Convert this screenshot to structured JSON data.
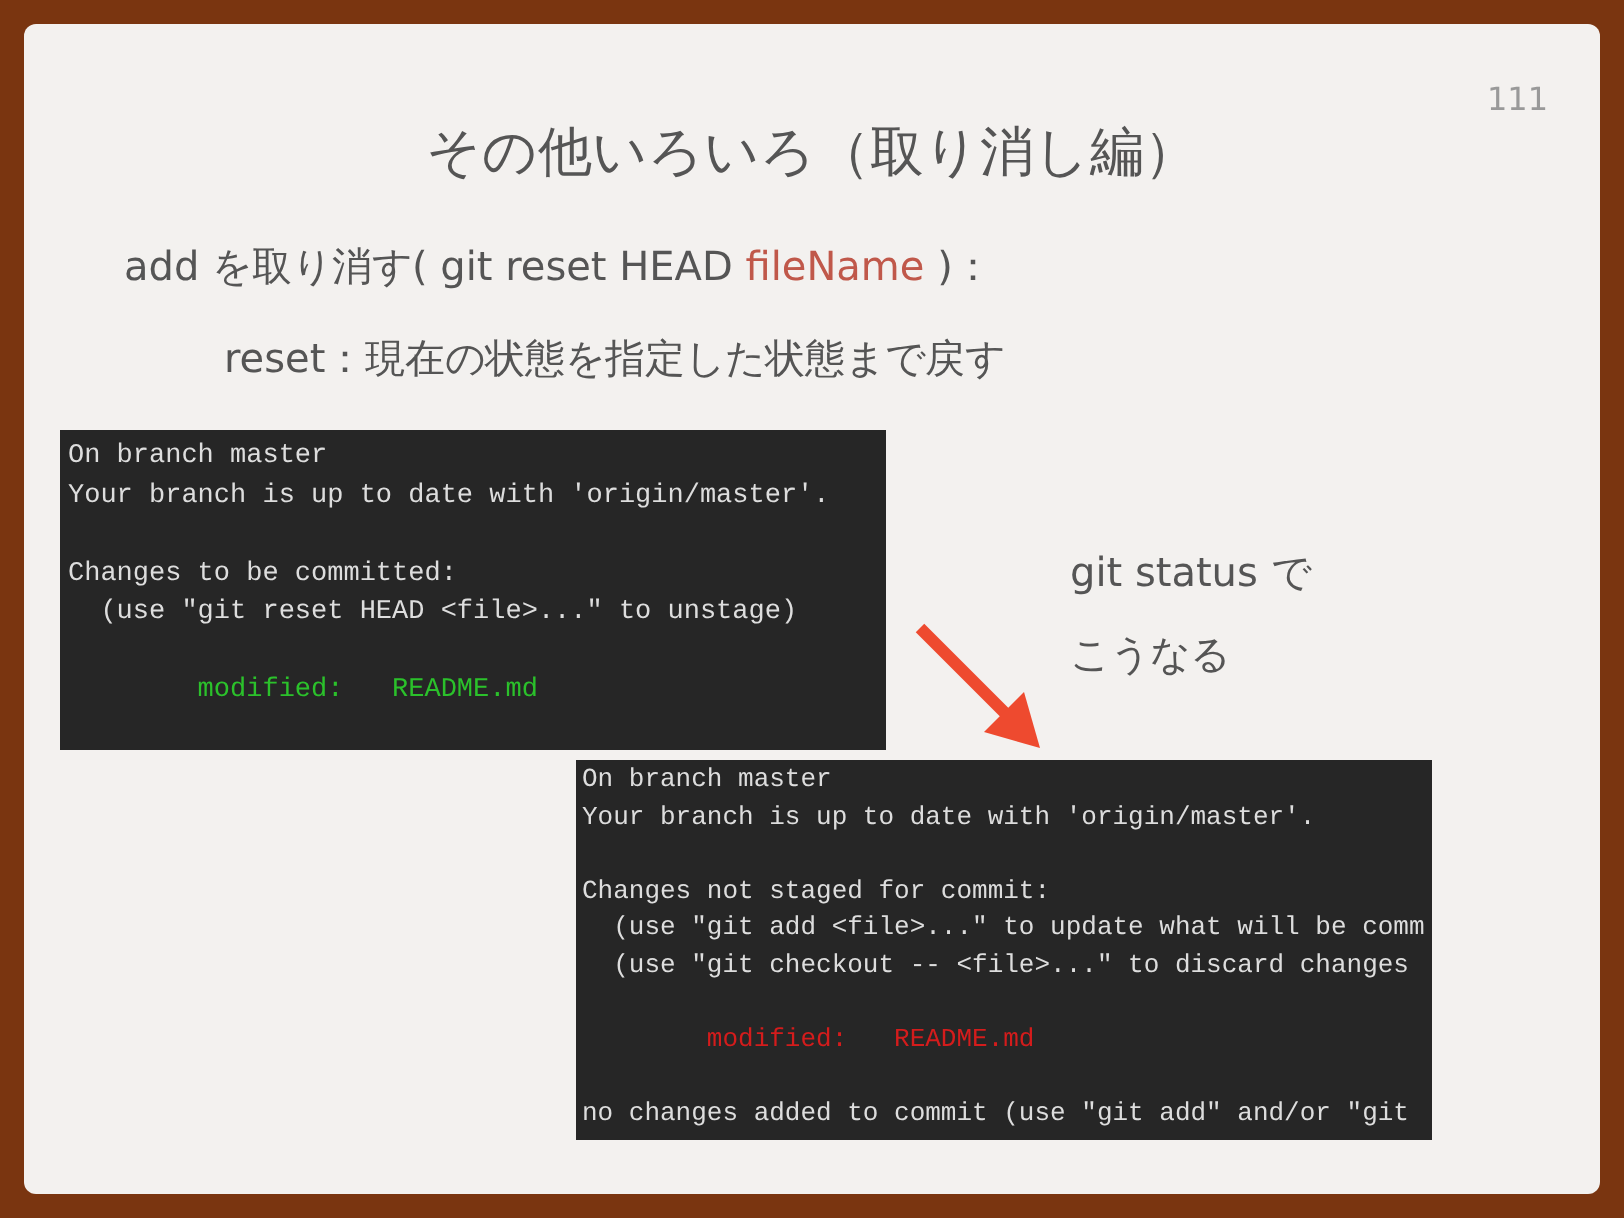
{
  "slide": {
    "page_number": "111",
    "title": "その他いろいろ（取り消し編）",
    "bullets": [
      {
        "segments": [
          {
            "text": "add を取り消す( git reset HEAD ",
            "kind": "plain"
          },
          {
            "text": "fileName",
            "kind": "placeholder"
          },
          {
            "text": " )：",
            "kind": "plain"
          }
        ]
      },
      {
        "segments": [
          {
            "text": "reset：現在の状態を指定した状態まで戻す",
            "kind": "plain"
          }
        ]
      }
    ],
    "terminals": [
      {
        "lines": [
          {
            "kind": "text",
            "text": "On branch master"
          },
          {
            "kind": "text",
            "text": "Your branch is up to date with 'origin/master'."
          },
          {
            "kind": "blank"
          },
          {
            "kind": "text",
            "text": "Changes to be committed:"
          },
          {
            "kind": "text",
            "text": "  (use \"git reset HEAD <file>...\" to unstage)"
          },
          {
            "kind": "blank"
          },
          {
            "kind": "status",
            "text": "        modified:   README.md",
            "color": "#2bc12b"
          }
        ]
      },
      {
        "lines": [
          {
            "kind": "text",
            "text": "On branch master"
          },
          {
            "kind": "text",
            "text": "Your branch is up to date with 'origin/master'."
          },
          {
            "kind": "blank"
          },
          {
            "kind": "text",
            "text": "Changes not staged for commit:"
          },
          {
            "kind": "text",
            "text": "  (use \"git add <file>...\" to update what will be comm"
          },
          {
            "kind": "text",
            "text": "  (use \"git checkout -- <file>...\" to discard changes"
          },
          {
            "kind": "blank"
          },
          {
            "kind": "status",
            "text": "        modified:   README.md",
            "color": "#d41c1c"
          },
          {
            "kind": "blank"
          },
          {
            "kind": "text",
            "text": "no changes added to commit (use \"git add\" and/or \"git"
          }
        ]
      }
    ],
    "caption": [
      "git status で",
      "こうなる"
    ]
  }
}
